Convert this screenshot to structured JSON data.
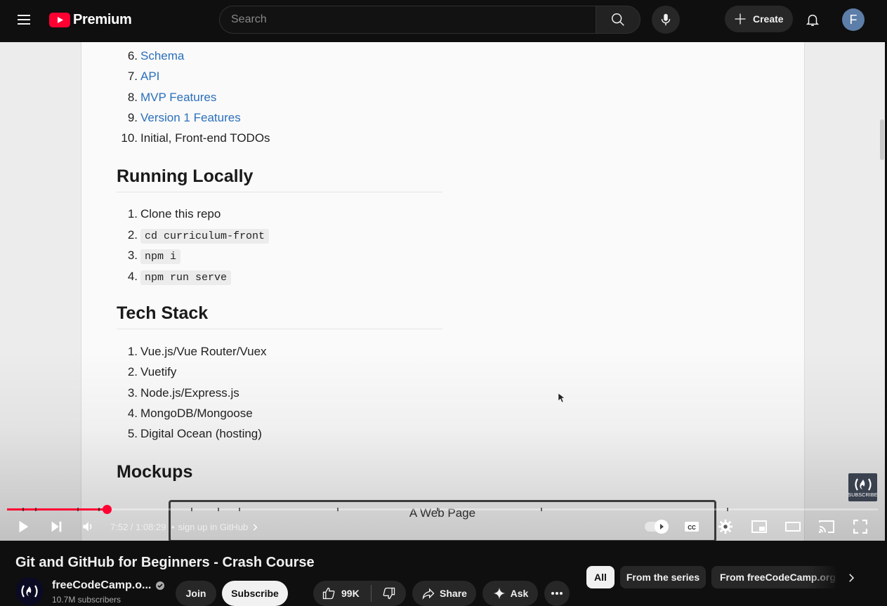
{
  "masthead": {
    "logo_text": "Premium",
    "search_placeholder": "Search",
    "create_label": "Create",
    "avatar_letter": "F"
  },
  "video_doc": {
    "list_top": [
      {
        "num": "6.",
        "text": "Schema",
        "link": true
      },
      {
        "num": "7.",
        "text": "API",
        "link": true
      },
      {
        "num": "8.",
        "text": "MVP Features",
        "link": true
      },
      {
        "num": "9.",
        "text": "Version 1 Features",
        "link": true
      },
      {
        "num": "10.",
        "text": "Initial, Front-end TODOs",
        "link": false
      }
    ],
    "heading_running": "Running Locally",
    "running_steps": [
      {
        "num": "1.",
        "text": "Clone this repo",
        "code": false
      },
      {
        "num": "2.",
        "text": "cd curriculum-front",
        "code": true
      },
      {
        "num": "3.",
        "text": "npm i",
        "code": true
      },
      {
        "num": "4.",
        "text": "npm run serve",
        "code": true
      }
    ],
    "heading_tech": "Tech Stack",
    "tech_items": [
      {
        "num": "1.",
        "text": "Vue.js/Vue Router/Vuex"
      },
      {
        "num": "2.",
        "text": "Vuetify"
      },
      {
        "num": "3.",
        "text": "Node.js/Express.js"
      },
      {
        "num": "4.",
        "text": "MongoDB/Mongoose"
      },
      {
        "num": "5.",
        "text": "Digital Ocean (hosting)"
      }
    ],
    "heading_mockups": "Mockups",
    "mockup_title": "A Web Page"
  },
  "player": {
    "watermark_label": "SUBSCRIBE",
    "time_display": "7:52 / 1:08:29",
    "chapter_separator": "•",
    "chapter_title": "sign up in GitHub",
    "progress_played_fraction": 0.1149,
    "progress_buffered_fraction": 0.118
  },
  "video_info": {
    "title": "Git and GitHub for Beginners - Crash Course",
    "channel_name": "freeCodeCamp.o...",
    "subscribers": "10.7M subscribers",
    "join_label": "Join",
    "subscribe_label": "Subscribe",
    "like_count": "99K",
    "share_label": "Share",
    "ask_label": "Ask"
  },
  "chips": [
    "All",
    "From the series",
    "From freeCodeCamp.org"
  ],
  "colors": {
    "accent": "#ff0033",
    "background": "#0f0f0f",
    "surface": "#272727",
    "link": "#2a6fbb"
  }
}
